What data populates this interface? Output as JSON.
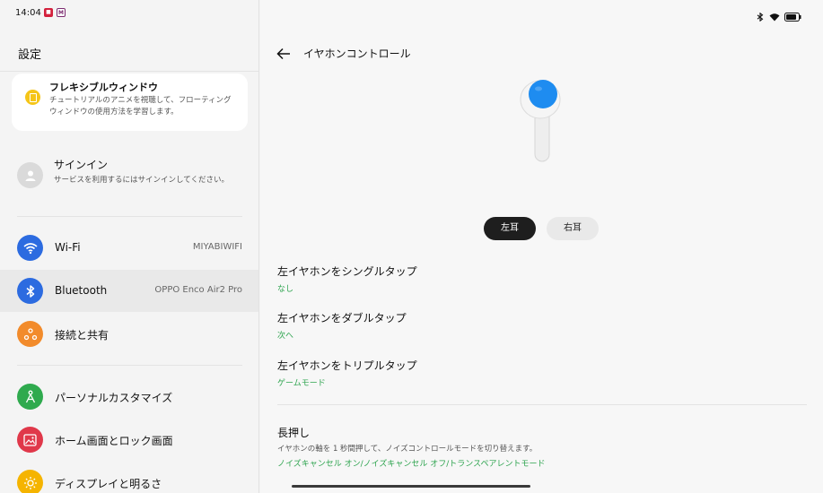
{
  "status_bar": {
    "time": "14:04",
    "app_icons": [
      "app-notification-icon",
      "app-m-icon"
    ]
  },
  "sidebar": {
    "title": "設定",
    "flex_card": {
      "title": "フレキシブルウィンドウ",
      "desc": "チュートリアルのアニメを視聴して、フローティングウィンドウの使用方法を学習します。"
    },
    "signin": {
      "title": "サインイン",
      "desc": "サービスを利用するにはサインインしてください。"
    },
    "items": [
      {
        "label": "Wi-Fi",
        "value": "MIYABIWIFI",
        "icon": "wifi-icon",
        "color": "#2c6be0"
      },
      {
        "label": "Bluetooth",
        "value": "OPPO Enco Air2 Pro",
        "icon": "bluetooth-icon",
        "color": "#2c6be0"
      },
      {
        "label": "接続と共有",
        "value": "",
        "icon": "share-icon",
        "color": "#f28b2b"
      },
      {
        "label": "パーソナルカスタマイズ",
        "value": "",
        "icon": "personalize-icon",
        "color": "#2faa4e"
      },
      {
        "label": "ホーム画面とロック画面",
        "value": "",
        "icon": "wallpaper-icon",
        "color": "#e0384a"
      },
      {
        "label": "ディスプレイと明るさ",
        "value": "",
        "icon": "brightness-icon",
        "color": "#f5b400"
      }
    ]
  },
  "detail": {
    "title": "イヤホンコントロール",
    "tabs": {
      "left": "左耳",
      "right": "右耳"
    },
    "options": [
      {
        "title": "左イヤホンをシングルタップ",
        "value": "なし"
      },
      {
        "title": "左イヤホンをダブルタップ",
        "value": "次へ"
      },
      {
        "title": "左イヤホンをトリプルタップ",
        "value": "ゲームモード"
      }
    ],
    "long_press": {
      "title": "長押し",
      "desc": "イヤホンの軸を 1 秒間押して、ノイズコントロールモードを切り替えます。",
      "value": "ノイズキャンセル オン/ノイズキャンセル オフ/トランスペアレントモード"
    }
  },
  "colors": {
    "accent_green": "#2ea44f",
    "earbud_blue": "#1e8cf0"
  }
}
